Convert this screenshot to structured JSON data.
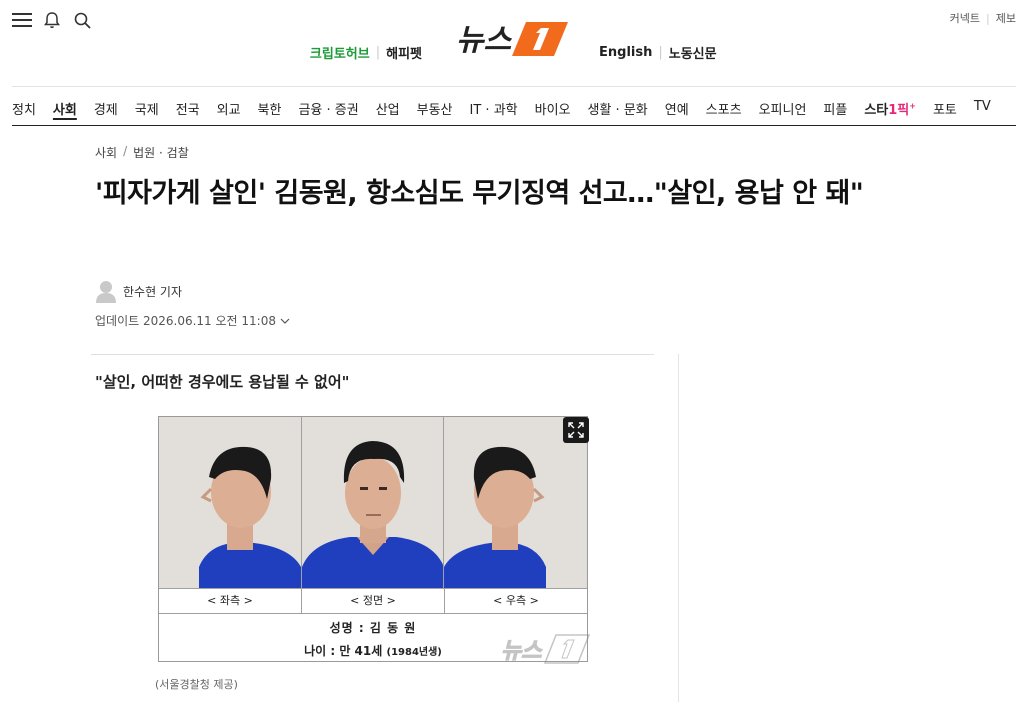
{
  "header": {
    "links_right": [
      "커넥트",
      "제보"
    ],
    "brand_left": [
      "크립토허브",
      "해피펫"
    ],
    "brand_right": [
      "English",
      "노동신문"
    ],
    "logo_text": "뉴스1",
    "icons": [
      "menu-icon",
      "bell-icon",
      "search-icon"
    ]
  },
  "nav": {
    "items": [
      "정치",
      "사회",
      "경제",
      "국제",
      "전국",
      "외교",
      "북한",
      "금융 · 증권",
      "산업",
      "부동산",
      "IT · 과학",
      "바이오",
      "생활 · 문화",
      "연예",
      "스포츠",
      "오피니언",
      "피플",
      "포토",
      "TV"
    ],
    "active": "사회",
    "star_label": "스타",
    "star_suffix": "1픽",
    "star_mark": "+"
  },
  "article": {
    "breadcrumb": [
      "사회",
      "법원 · 검찰"
    ],
    "title": "'피자가게 살인' 김동원, 항소심도 무기징역 선고…\"살인, 용납 안 돼\"",
    "reporter": "한수현 기자",
    "updated": "업데이트 2026.06.11 오전 11:08",
    "subtitle": "\"살인, 어떠한 경우에도 용납될 수 없어\""
  },
  "photo": {
    "labels": [
      "< 좌측 >",
      "< 정면 >",
      "< 우측 >"
    ],
    "name_line": "성명 : 김 동 원",
    "age_line": "나이 : 만 41세",
    "age_small": "(1984년생)",
    "caption": "(서울경찰청 제공)"
  },
  "colors": {
    "brand_green": "#1d9b3a",
    "logo_orange": "#f26b1d",
    "star_pink": "#e6287a"
  }
}
